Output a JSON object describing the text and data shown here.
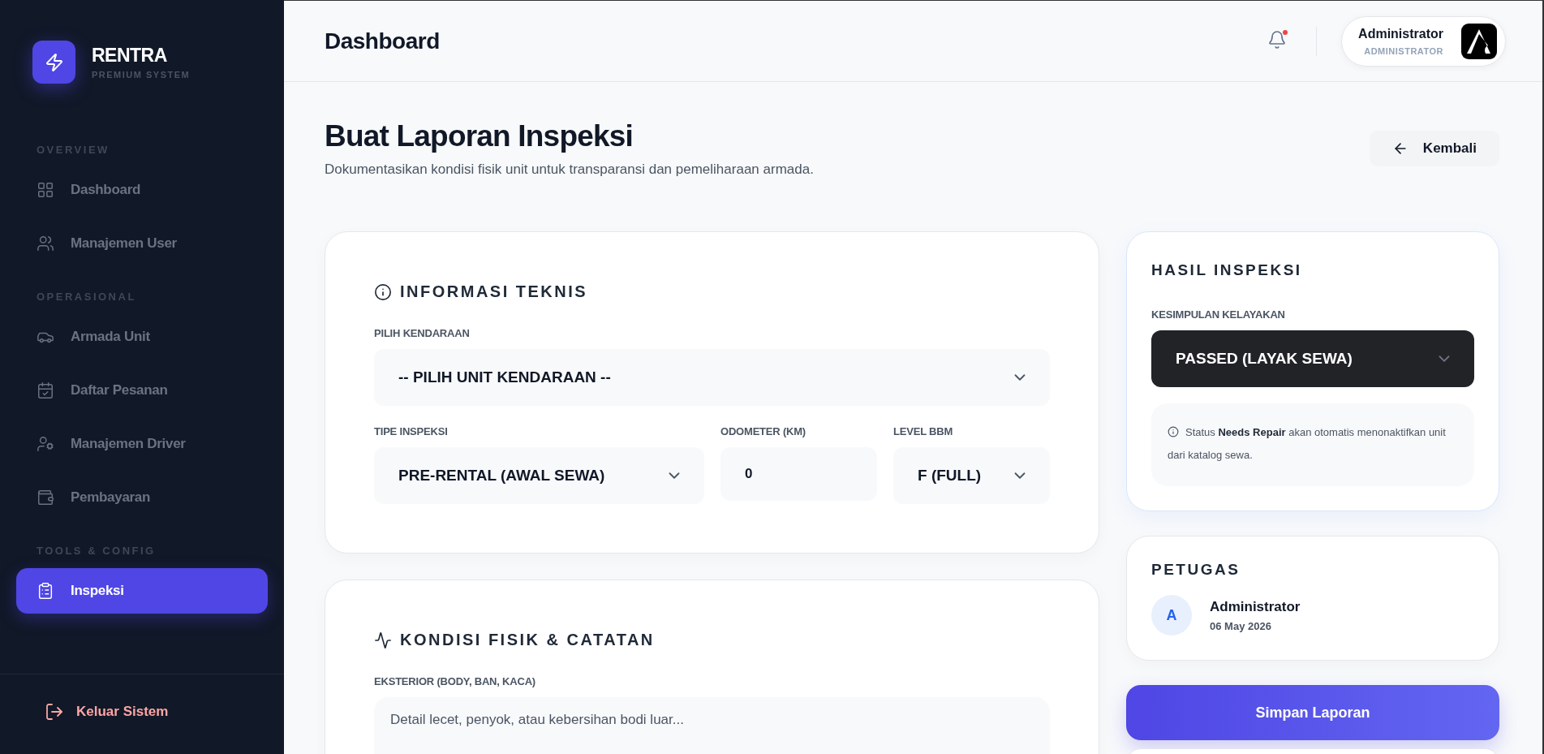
{
  "sidebar": {
    "brand": {
      "name": "RENTRA",
      "tagline": "PREMIUM SYSTEM"
    },
    "sections": [
      {
        "title": "OVERVIEW",
        "items": [
          {
            "label": "Dashboard",
            "kind": "grid",
            "selected": false
          },
          {
            "label": "Manajemen User",
            "kind": "users",
            "selected": false
          }
        ]
      },
      {
        "title": "OPERASIONAL",
        "items": [
          {
            "label": "Armada Unit",
            "kind": "car",
            "selected": false
          },
          {
            "label": "Daftar Pesanan",
            "kind": "calendar",
            "selected": false
          },
          {
            "label": "Manajemen Driver",
            "kind": "usercog",
            "selected": false
          },
          {
            "label": "Pembayaran",
            "kind": "wallet",
            "selected": false
          }
        ]
      },
      {
        "title": "TOOLS & CONFIG",
        "items": [
          {
            "label": "Inspeksi",
            "kind": "clipboard",
            "selected": true
          }
        ]
      }
    ],
    "logout": "Keluar Sistem"
  },
  "header": {
    "title": "Dashboard",
    "notification": true,
    "user": {
      "name": "Administrator",
      "role": "ADMINISTRATOR"
    }
  },
  "page": {
    "title": "Buat Laporan Inspeksi",
    "subtitle": "Dokumentasikan kondisi fisik unit untuk transparansi dan pemeliharaan armada.",
    "back": "Kembali"
  },
  "technical": {
    "title": "INFORMASI TEKNIS",
    "vehicle": {
      "label": "PILIH KENDARAAN",
      "value": "-- PILIH UNIT KENDARAAN --"
    },
    "fields": [
      {
        "kind": "select",
        "label": "TIPE INSPEKSI",
        "value": "PRE-RENTAL (AWAL SEWA)"
      },
      {
        "kind": "input",
        "label": "ODOMETER (KM)",
        "value": "0"
      },
      {
        "kind": "select",
        "label": "LEVEL BBM",
        "value": "F (FULL)"
      }
    ]
  },
  "condition": {
    "title": "KONDISI FISIK & CATATAN",
    "fields": [
      {
        "label": "EKSTERIOR (BODY, BAN, KACA)",
        "placeholder": "Detail lecet, penyok, atau kebersihan bodi luar..."
      }
    ]
  },
  "result": {
    "title": "HASIL INSPEKSI",
    "label": "KESIMPULAN KELAYAKAN",
    "value": "PASSED (LAYAK SEWA)",
    "note": "Status **Needs Repair** akan otomatis menonaktifkan unit dari katalog sewa."
  },
  "officer": {
    "title": "PETUGAS",
    "initial": "A",
    "name": "Administrator",
    "date": "06 May 2026"
  },
  "save": "Simpan Laporan"
}
